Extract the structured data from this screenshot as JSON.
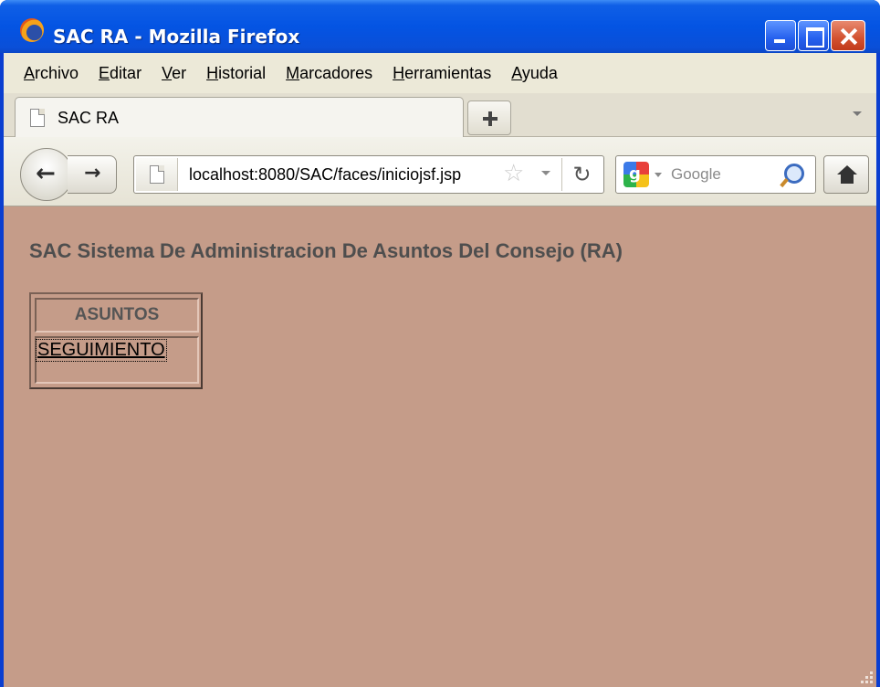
{
  "window": {
    "title": "SAC RA - Mozilla Firefox"
  },
  "menubar": {
    "items": [
      {
        "accel": "A",
        "rest": "rchivo"
      },
      {
        "accel": "E",
        "rest": "ditar"
      },
      {
        "accel": "V",
        "rest": "er"
      },
      {
        "accel": "H",
        "rest": "istorial"
      },
      {
        "accel": "M",
        "rest": "arcadores"
      },
      {
        "accel": "H",
        "rest": "erramientas"
      },
      {
        "accel": "A",
        "rest": "yuda"
      }
    ]
  },
  "tabs": [
    {
      "label": "SAC RA"
    }
  ],
  "navbar": {
    "url": "localhost:8080/SAC/faces/iniciojsf.jsp",
    "search_placeholder": "Google"
  },
  "page": {
    "heading": "SAC Sistema De Administracion De Asuntos Del Consejo (RA)",
    "menu": {
      "header": "ASUNTOS",
      "links": [
        "SEGUIMIENTO"
      ]
    },
    "background_color": "#c59c89"
  }
}
